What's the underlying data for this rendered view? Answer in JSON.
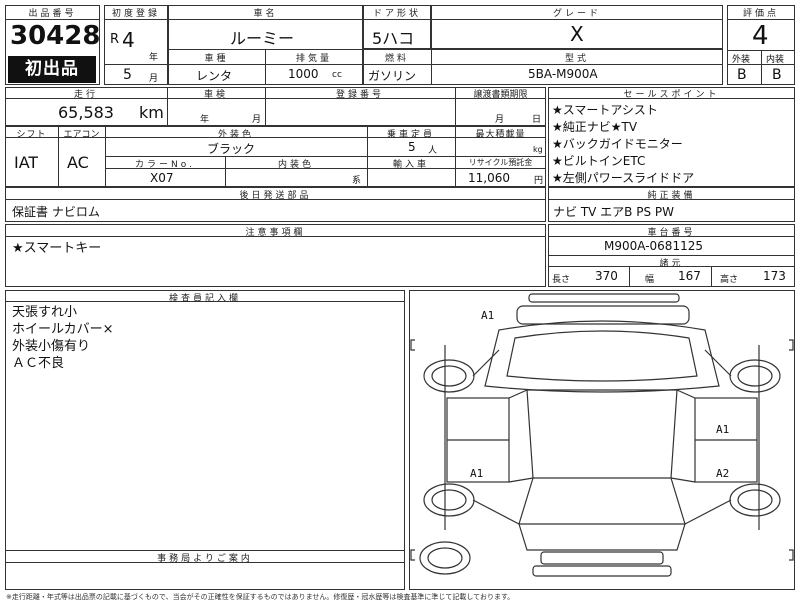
{
  "headers": {
    "lot_no": "出品番号",
    "first_reg": "初度登録",
    "car_name": "車名",
    "door_type": "ドア形状",
    "grade": "グレード",
    "score": "評価点",
    "shaken": "車検",
    "reg_no": "登録番号",
    "transfer_deadline": "譲渡書類期限",
    "sales_points": "セールスポイント",
    "body_type": "車種",
    "displacement": "排気量",
    "fuel": "燃料",
    "model": "型式",
    "exterior_interior": "外装|内装",
    "mileage": "走行",
    "shift": "シフト",
    "aircon": "エアコン",
    "ext_color": "外装色",
    "capacity": "乗車定員",
    "max_load": "最大積載量",
    "color_no": "カラーNo.",
    "int_color": "内装色",
    "import_car": "輸入車",
    "recycle_fee": "リサイクル預託金",
    "parts": "後日発送部品",
    "equipment": "純正装備",
    "notes": "注意事項欄",
    "chassis_no": "車台番号",
    "dimensions": "諸元",
    "inspector": "検査員記入欄",
    "office": "事務局よりご案内"
  },
  "vehicle": {
    "lot_number": "30428",
    "badge": "初出品",
    "era": "R",
    "year": "4",
    "year_unit": "年",
    "month": "5",
    "month_unit": "月",
    "car_name": "ルーミー",
    "door_type": "5ハコ",
    "grade": "X",
    "score": "4",
    "body_type": "レンタ",
    "displacement": "1000",
    "displacement_unit": "cc",
    "fuel": "ガソリン",
    "model": "5BA-M900A",
    "exterior_score": "B",
    "interior_score": "B",
    "exterior_label": "外装",
    "interior_label": "内装",
    "mileage": "65,583",
    "mileage_unit": "km",
    "shaken_year_unit": "年",
    "shaken_month_unit": "月",
    "transfer_month_unit": "月",
    "transfer_day_unit": "日",
    "shift": "IAT",
    "aircon": "AC",
    "ext_color": "ブラック",
    "capacity": "5",
    "capacity_unit": "人",
    "max_load_unit": "kg",
    "color_no": "X07",
    "int_color_unit": "系",
    "recycle_fee": "11,060",
    "recycle_unit": "円",
    "parts": "保証書 ナビロム",
    "equipment": "ナビ TV エアB PS PW",
    "chassis_no": "M900A-0681125",
    "length_label": "長さ",
    "length": "370",
    "width_label": "幅",
    "width": "167",
    "height_label": "高さ",
    "height": "173"
  },
  "sales_points": [
    "★スマートアシスト",
    "★純正ナビ★TV",
    "★バックガイドモニター",
    "★ビルトインETC",
    "★左側パワースライドドア"
  ],
  "notes": [
    "★スマートキー"
  ],
  "inspector_notes": [
    "天張すれ小",
    "ホイールカバー×",
    "外装小傷有り",
    "ＡＣ不良"
  ],
  "diagram_marks": {
    "front_left": "A1",
    "right_front": "A1",
    "left_rear": "A1",
    "right_rear": "A2"
  },
  "footer": "※走行距離・年式等は出品票の記載に基づくもので、当会がその正確性を保証するものではありません。修復歴・冠水歴等は検査基準に準じて記載しております。"
}
